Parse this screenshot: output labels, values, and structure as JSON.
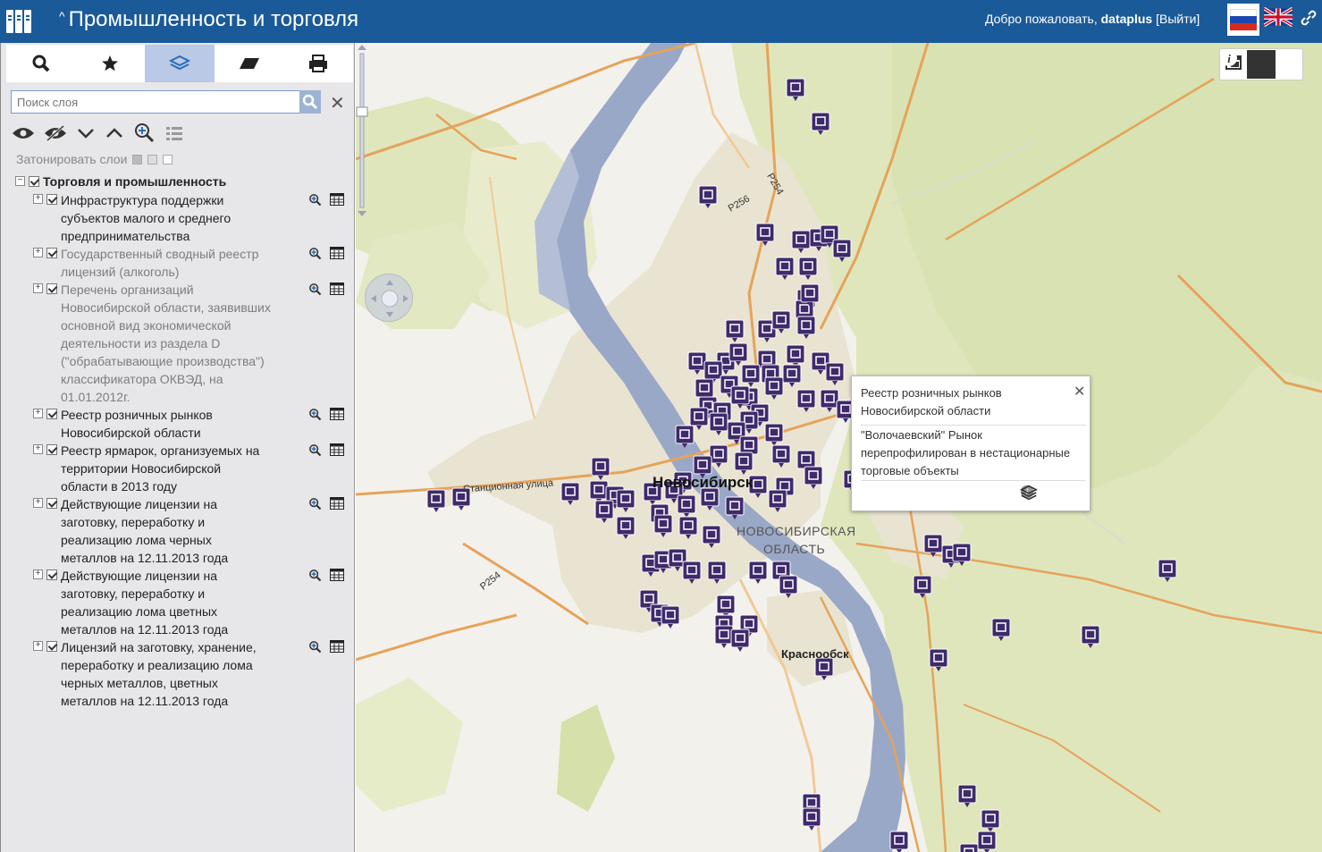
{
  "header": {
    "title": "Промышленность и торговля",
    "welcome_prefix": "Добро пожаловать,",
    "username": "dataplus",
    "logout": "[Выйти]"
  },
  "sidebar": {
    "tabs": [
      {
        "icon": "search-icon"
      },
      {
        "icon": "star-icon"
      },
      {
        "icon": "layers-icon",
        "active": true
      },
      {
        "icon": "eraser-icon"
      },
      {
        "icon": "print-icon"
      }
    ],
    "search_placeholder": "Поиск слоя",
    "shade_label": "Затонировать слои",
    "group": {
      "label": "Торговля и промышленность",
      "layers": [
        {
          "lines": [
            "Инфраструктура поддержки",
            "субъектов малого и среднего",
            "предпринимательства"
          ],
          "dim": false
        },
        {
          "lines": [
            "Государственный сводный реестр",
            "лицензий (алкоголь)"
          ],
          "dim": true
        },
        {
          "lines": [
            "Перечень организаций",
            "Новосибирской области, заявивших",
            "основной вид экономической",
            "деятельности из раздела D",
            "(\"обрабатывающие производства\")",
            "классификатора ОКВЭД, на",
            "01.01.2012г."
          ],
          "dim": true
        },
        {
          "lines": [
            "Реестр розничных рынков",
            "Новосибирской области"
          ],
          "dim": false
        },
        {
          "lines": [
            "Реестр ярмарок, организуемых на",
            "территории Новосибирской",
            "области в 2013 году"
          ],
          "dim": false
        },
        {
          "lines": [
            "Действующие лицензии на",
            "заготовку, переработку и",
            "реализацию лома черных",
            "металлов на 12.11.2013 года"
          ],
          "dim": false
        },
        {
          "lines": [
            "Действующие лицензии на",
            "заготовку, переработку и",
            "реализацию лома цветных",
            "металлов на 12.11.2013 года"
          ],
          "dim": false
        },
        {
          "lines": [
            "Лицензий на заготовку, хранение,",
            "переработку и реализацию лома",
            "черных металлов, цветных",
            "металлов на 12.11.2013 года"
          ],
          "dim": false
        }
      ]
    }
  },
  "map": {
    "labels": {
      "city": "Новосибирск",
      "region_line1": "НОВОСИБИРСКАЯ",
      "region_line2": "ОБЛАСТЬ",
      "suburb": "Краснообск",
      "street_stantsionnaya": "Станционная улица",
      "road_p254": "Р254",
      "road_p256": "Р256",
      "road_p254b": "Р254"
    },
    "popup": {
      "title": "Реестр розничных рынков Новосибирской области",
      "body": "\"Волочаевский\" Рынок перепрофилирован в нестационарные торговые объекты"
    },
    "marker_colors": {
      "market": "#b3283f",
      "fair": "#3f2a6b",
      "scrap": "#2e6f78",
      "alcohol": "#9a7a1e",
      "support": "#c05a2a"
    }
  }
}
